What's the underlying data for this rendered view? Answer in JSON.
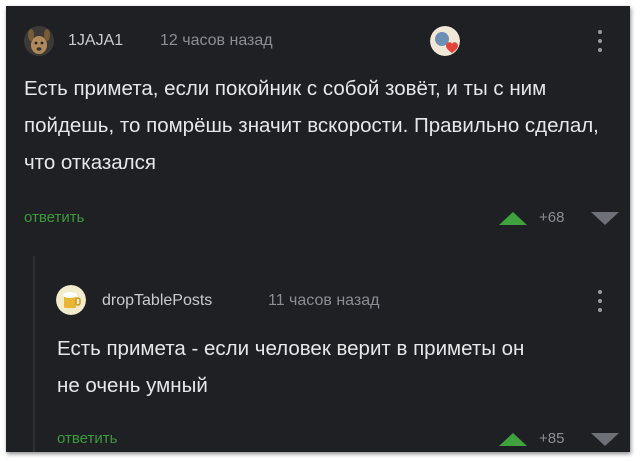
{
  "comments": [
    {
      "author": "1JAJA1",
      "time": "12 часов назад",
      "text": "Есть примета, если покойник с собой зовёт, и ты с ним пойдешь, то помрёшь значит вскорости. Правильно сделал, что отказался",
      "reply_label": "ответить",
      "rating": "+68"
    },
    {
      "author": "dropTablePosts",
      "time": "11 часов назад",
      "text": "Есть примета - если человек верит в приметы он не очень умный",
      "reply_label": "ответить",
      "rating": "+85"
    }
  ],
  "icons": {
    "avatar_1": "dog-avatar-icon",
    "avatar_2": "beer-avatar-icon",
    "award": "heart-award-icon",
    "more": "more-vertical-icon",
    "upvote": "upvote-arrow-icon",
    "downvote": "downvote-arrow-icon"
  },
  "colors": {
    "background": "#1f2024",
    "text": "#e6e7e9",
    "meta": "#8b8e94",
    "reply": "#3d9a3d",
    "upvote": "#3fa23f",
    "downvote": "#6d7076"
  }
}
